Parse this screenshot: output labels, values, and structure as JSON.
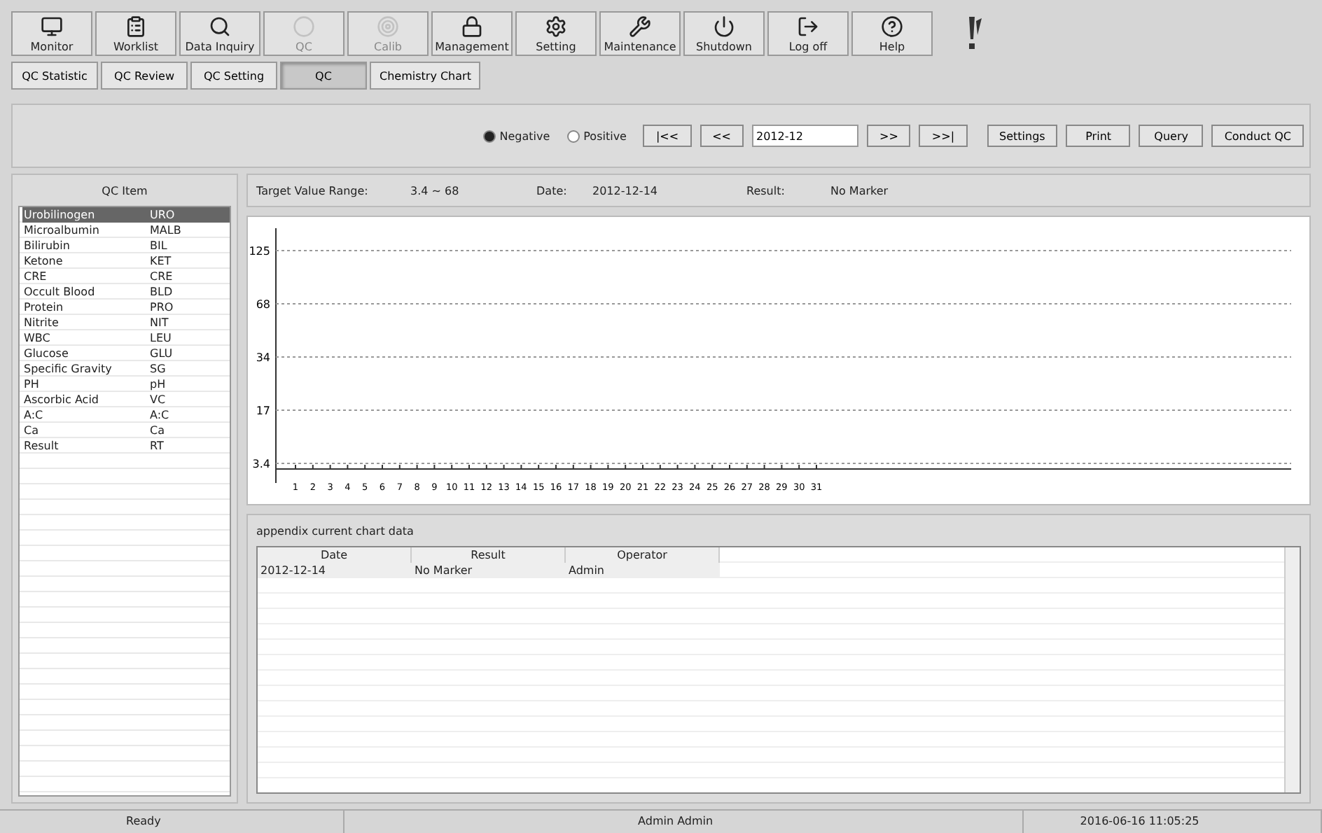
{
  "toolbar": [
    {
      "label": "Monitor",
      "disabled": false
    },
    {
      "label": "Worklist",
      "disabled": false
    },
    {
      "label": "Data Inquiry",
      "disabled": false
    },
    {
      "label": "QC",
      "disabled": true
    },
    {
      "label": "Calib",
      "disabled": true
    },
    {
      "label": "Management",
      "disabled": false
    },
    {
      "label": "Setting",
      "disabled": false
    },
    {
      "label": "Maintenance",
      "disabled": false
    },
    {
      "label": "Shutdown",
      "disabled": false
    },
    {
      "label": "Log off",
      "disabled": false
    },
    {
      "label": "Help",
      "disabled": false
    }
  ],
  "subtabs": [
    {
      "label": "QC Statistic",
      "selected": false
    },
    {
      "label": "QC Review",
      "selected": false
    },
    {
      "label": "QC Setting",
      "selected": false
    },
    {
      "label": "QC",
      "selected": true
    },
    {
      "label": "Chemistry Chart",
      "selected": false
    }
  ],
  "filter": {
    "levels": [
      {
        "label": "Negative",
        "selected": true
      },
      {
        "label": "Positive",
        "selected": false
      }
    ],
    "nav_first": "|<<",
    "nav_prev": "<<",
    "month": "2012-12",
    "nav_next": ">>",
    "nav_last": ">>|",
    "buttons": [
      "Settings",
      "Print",
      "Query",
      "Conduct QC"
    ]
  },
  "qc_items": {
    "header": "QC Item",
    "rows": [
      {
        "name": "Urobilinogen",
        "code": "URO",
        "selected": true
      },
      {
        "name": "Microalbumin",
        "code": "MALB",
        "selected": false
      },
      {
        "name": "Bilirubin",
        "code": "BIL",
        "selected": false
      },
      {
        "name": "Ketone",
        "code": "KET",
        "selected": false
      },
      {
        "name": "CRE",
        "code": "CRE",
        "selected": false
      },
      {
        "name": "Occult Blood",
        "code": "BLD",
        "selected": false
      },
      {
        "name": "Protein",
        "code": "PRO",
        "selected": false
      },
      {
        "name": "Nitrite",
        "code": "NIT",
        "selected": false
      },
      {
        "name": "WBC",
        "code": "LEU",
        "selected": false
      },
      {
        "name": "Glucose",
        "code": "GLU",
        "selected": false
      },
      {
        "name": "Specific Gravity",
        "code": "SG",
        "selected": false
      },
      {
        "name": "PH",
        "code": "pH",
        "selected": false
      },
      {
        "name": "Ascorbic Acid",
        "code": "VC",
        "selected": false
      },
      {
        "name": "A:C",
        "code": "A:C",
        "selected": false
      },
      {
        "name": "Ca",
        "code": "Ca",
        "selected": false
      },
      {
        "name": "Result",
        "code": "RT",
        "selected": false
      }
    ]
  },
  "info": {
    "range_label": "Target Value Range:",
    "range": "3.4 ~ 68",
    "date_label": "Date:",
    "date": "2012-12-14",
    "result_label": "Result:",
    "result": "No Marker"
  },
  "chart": {
    "x_labels": [
      "1",
      "2",
      "3",
      "4",
      "5",
      "6",
      "7",
      "8",
      "9",
      "10",
      "11",
      "12",
      "13",
      "14",
      "15",
      "16",
      "17",
      "18",
      "19",
      "20",
      "21",
      "22",
      "23",
      "24",
      "25",
      "26",
      "27",
      "28",
      "29",
      "30",
      "31"
    ],
    "y_labels": [
      "125",
      "68",
      "34",
      "17",
      "3.4"
    ]
  },
  "appendix": {
    "title": "appendix current chart data",
    "columns": [
      "Date",
      "Result",
      "Operator"
    ],
    "rows": [
      [
        "2012-12-14",
        "No Marker",
        "Admin"
      ]
    ]
  },
  "status_bar": [
    "Ready",
    "Admin Admin",
    "2016-06-16 11:05:25"
  ]
}
